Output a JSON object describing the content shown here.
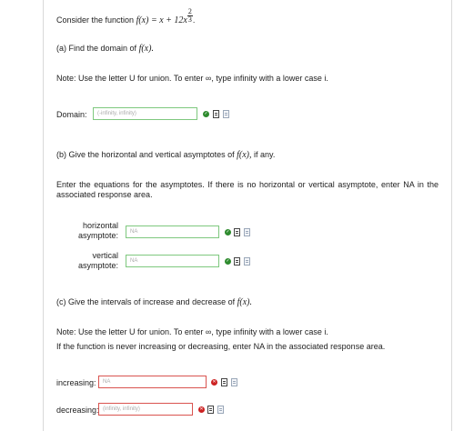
{
  "intro": {
    "prefix": "Consider the function",
    "f_expr": "f(x) = x + 12x",
    "exp_num": "2",
    "exp_den": "3",
    "suffix": "."
  },
  "part_a": {
    "heading": "(a) Find the domain of",
    "heading_math": "f(x).",
    "note": "Note: Use the letter U for union. To enter ∞, type infinity with a lower case i.",
    "domain_label": "Domain:",
    "domain_value": "(-infinity, infinity)",
    "domain_status": "correct"
  },
  "part_b": {
    "heading": "(b) Give the horizontal and vertical asymptotes of",
    "heading_math": "f(x),",
    "heading_suffix": "if any.",
    "instructions": "Enter the equations for the asymptotes. If there is no horizontal or vertical asymptote, enter NA in the associated response area.",
    "horizontal_label_1": "horizontal",
    "horizontal_label_2": "asymptote:",
    "horizontal_value": "NA",
    "horizontal_status": "correct",
    "vertical_label_1": "vertical",
    "vertical_label_2": "asymptote:",
    "vertical_value": "NA",
    "vertical_status": "correct"
  },
  "part_c": {
    "heading": "(c) Give the intervals of increase and decrease of",
    "heading_math": "f(x).",
    "note_1": "Note: Use the letter U for union. To enter ∞, type infinity with a lower case i.",
    "note_2": "If the function is never increasing or decreasing, enter NA in the associated response area.",
    "increasing_label": "increasing:",
    "increasing_value": "NA",
    "increasing_status": "incorrect",
    "decreasing_label": "decreasing:",
    "decreasing_value": "(infinity, infinity)",
    "decreasing_status": "incorrect"
  },
  "colors": {
    "correct_border": "#7ec87e",
    "incorrect_border": "#d9534f",
    "correct_icon": "#2e8b2e",
    "incorrect_icon": "#cc2222"
  },
  "icons": {
    "correct": "check-icon",
    "incorrect": "x-icon",
    "help": "document-icon",
    "preview": "page-icon"
  }
}
